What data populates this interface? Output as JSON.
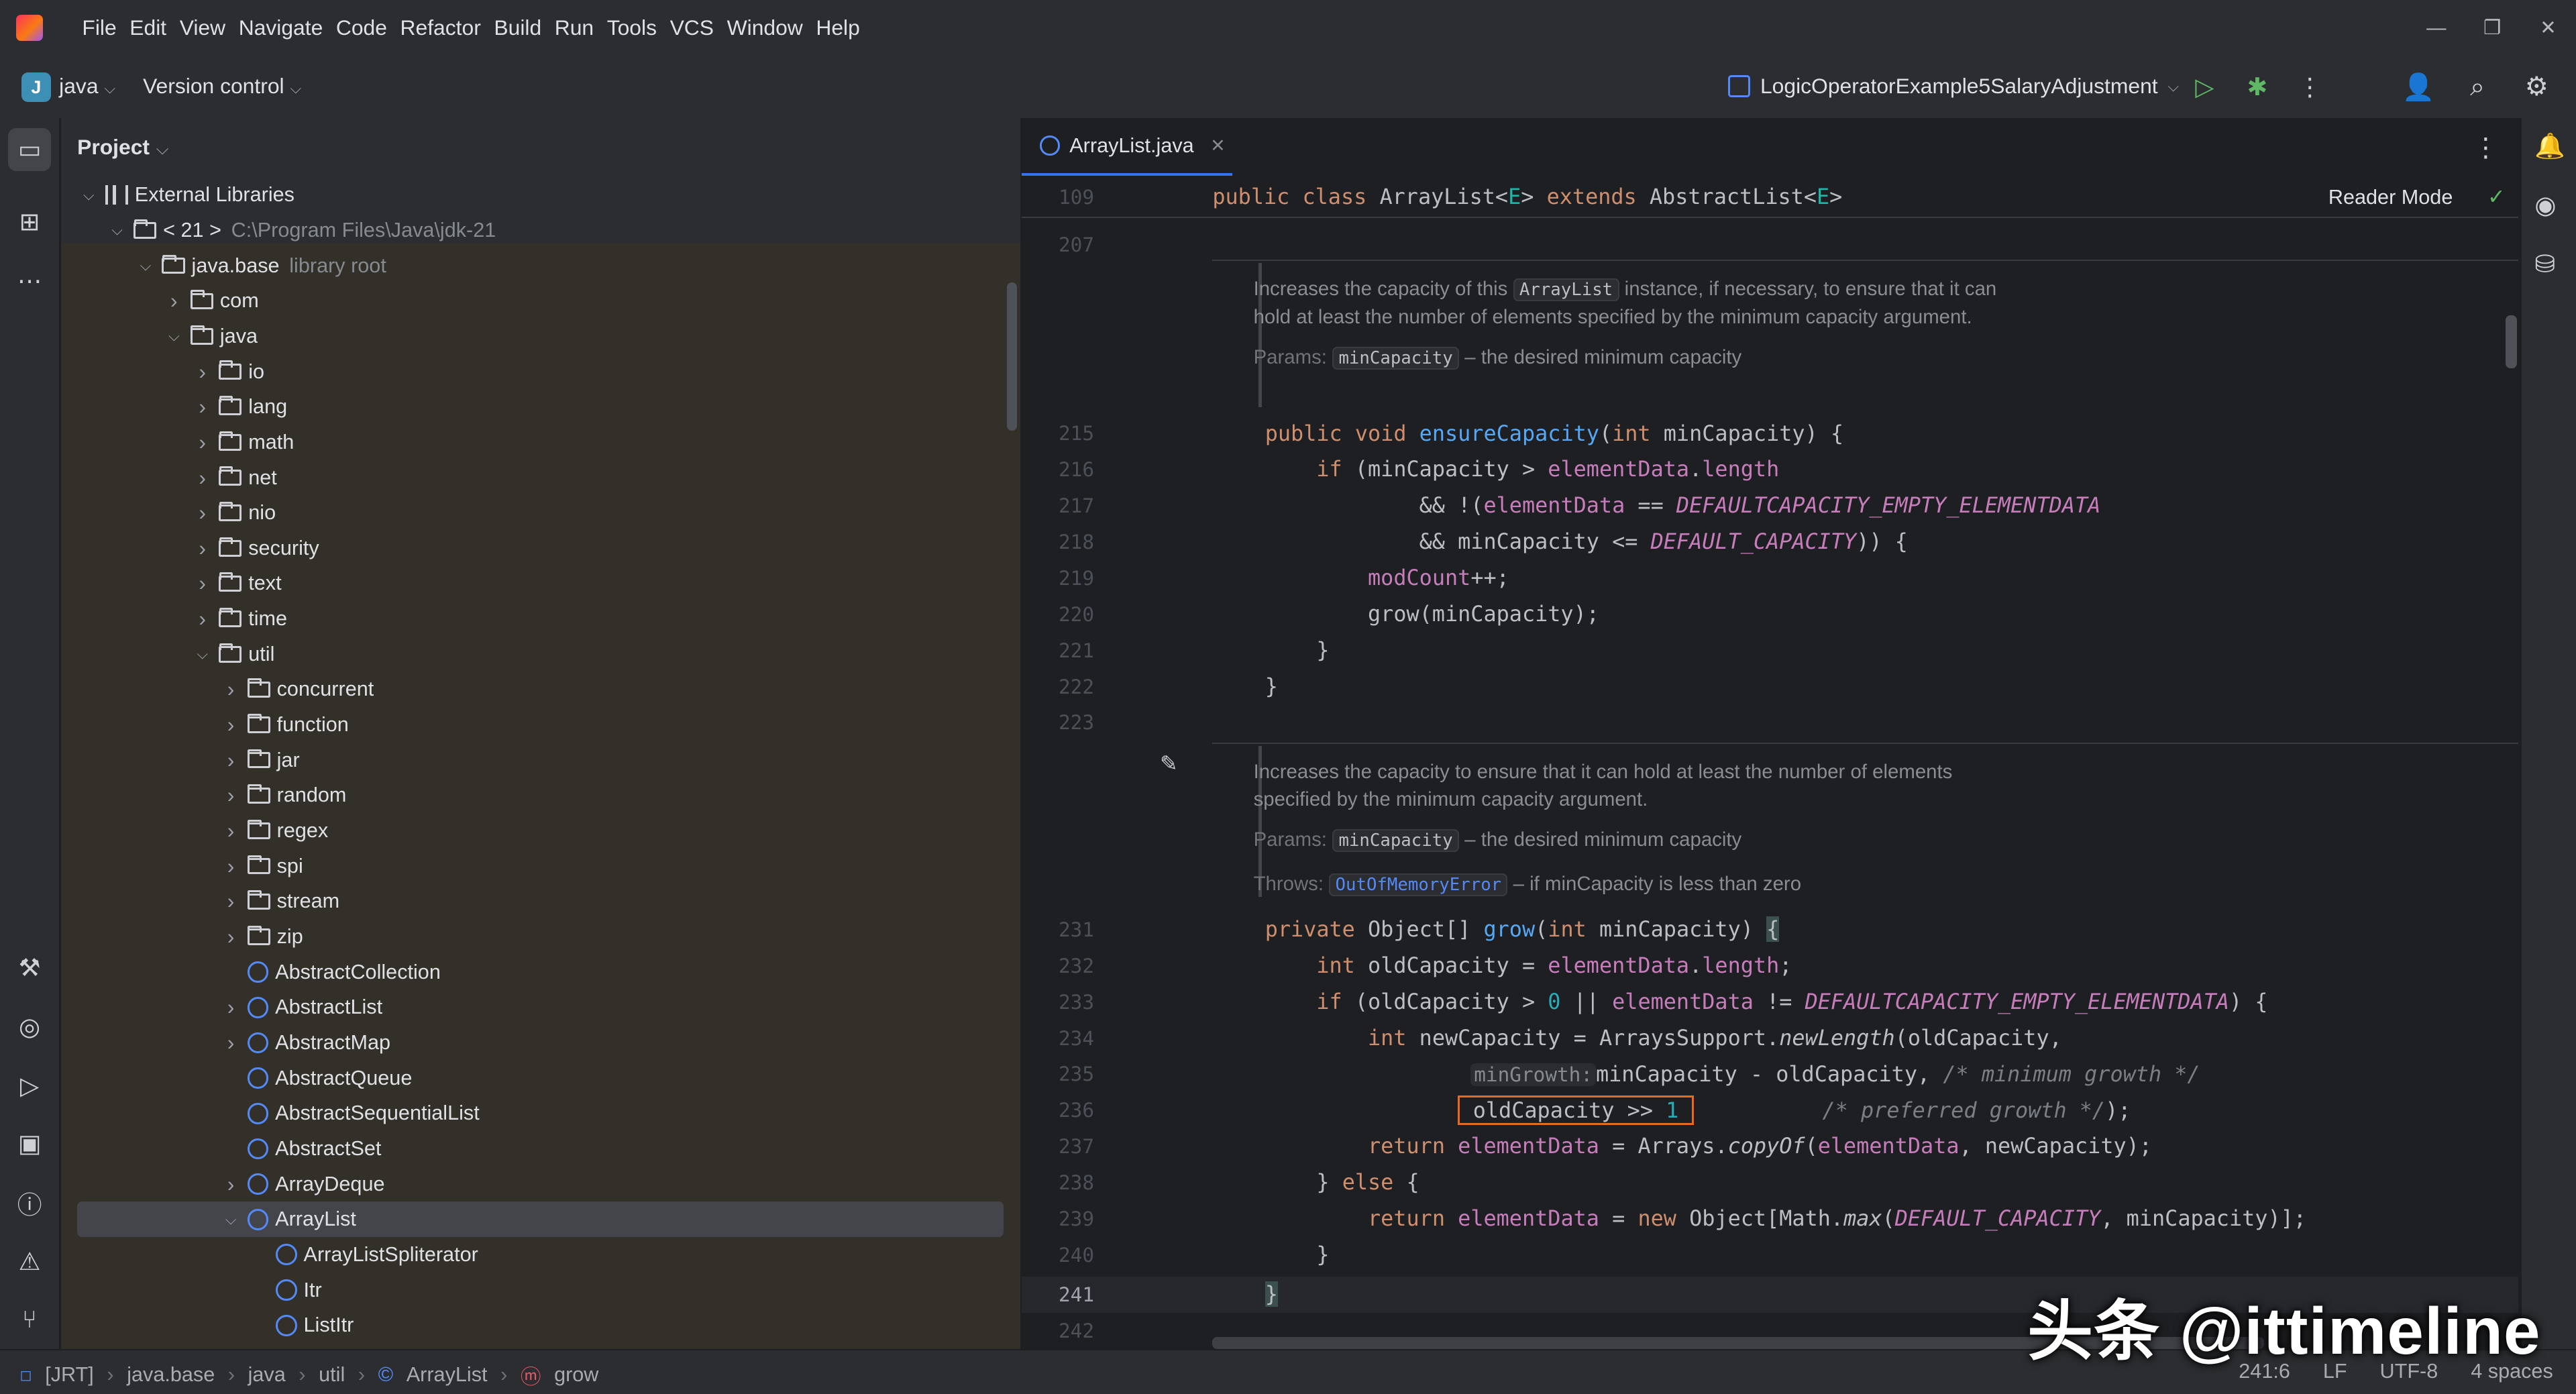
{
  "menu": [
    "File",
    "Edit",
    "View",
    "Navigate",
    "Code",
    "Refactor",
    "Build",
    "Run",
    "Tools",
    "VCS",
    "Window",
    "Help"
  ],
  "toolbar": {
    "project_badge": "J",
    "project_name": "java",
    "version_control": "Version control",
    "run_config": "LogicOperatorExample5SalaryAdjustment"
  },
  "project_panel": {
    "title": "Project",
    "tree": [
      {
        "label": "External Libraries",
        "depth": 0,
        "type": "lib",
        "expanded": true
      },
      {
        "label": "< 21 >",
        "sub": "C:\\Program Files\\Java\\jdk-21",
        "depth": 1,
        "type": "jdk",
        "expanded": true
      },
      {
        "label": "java.base",
        "sub": "library root",
        "depth": 2,
        "type": "folder",
        "expanded": true
      },
      {
        "label": "com",
        "depth": 3,
        "type": "folder",
        "expanded": false
      },
      {
        "label": "java",
        "depth": 3,
        "type": "folder",
        "expanded": true
      },
      {
        "label": "io",
        "depth": 4,
        "type": "folder",
        "expanded": false
      },
      {
        "label": "lang",
        "depth": 4,
        "type": "folder",
        "expanded": false
      },
      {
        "label": "math",
        "depth": 4,
        "type": "folder",
        "expanded": false
      },
      {
        "label": "net",
        "depth": 4,
        "type": "folder",
        "expanded": false
      },
      {
        "label": "nio",
        "depth": 4,
        "type": "folder",
        "expanded": false
      },
      {
        "label": "security",
        "depth": 4,
        "type": "folder",
        "expanded": false
      },
      {
        "label": "text",
        "depth": 4,
        "type": "folder",
        "expanded": false
      },
      {
        "label": "time",
        "depth": 4,
        "type": "folder",
        "expanded": false
      },
      {
        "label": "util",
        "depth": 4,
        "type": "folder",
        "expanded": true
      },
      {
        "label": "concurrent",
        "depth": 5,
        "type": "folder",
        "expanded": false
      },
      {
        "label": "function",
        "depth": 5,
        "type": "folder",
        "expanded": false
      },
      {
        "label": "jar",
        "depth": 5,
        "type": "folder",
        "expanded": false
      },
      {
        "label": "random",
        "depth": 5,
        "type": "folder",
        "expanded": false
      },
      {
        "label": "regex",
        "depth": 5,
        "type": "folder",
        "expanded": false
      },
      {
        "label": "spi",
        "depth": 5,
        "type": "folder",
        "expanded": false
      },
      {
        "label": "stream",
        "depth": 5,
        "type": "folder",
        "expanded": false
      },
      {
        "label": "zip",
        "depth": 5,
        "type": "folder",
        "expanded": false
      },
      {
        "label": "AbstractCollection",
        "depth": 5,
        "type": "class",
        "leaf": true
      },
      {
        "label": "AbstractList",
        "depth": 5,
        "type": "class",
        "expanded": false
      },
      {
        "label": "AbstractMap",
        "depth": 5,
        "type": "class",
        "expanded": false
      },
      {
        "label": "AbstractQueue",
        "depth": 5,
        "type": "class",
        "leaf": true
      },
      {
        "label": "AbstractSequentialList",
        "depth": 5,
        "type": "class",
        "leaf": true
      },
      {
        "label": "AbstractSet",
        "depth": 5,
        "type": "class",
        "leaf": true
      },
      {
        "label": "ArrayDeque",
        "depth": 5,
        "type": "class",
        "expanded": false
      },
      {
        "label": "ArrayList",
        "depth": 5,
        "type": "class",
        "expanded": true,
        "selected": true
      },
      {
        "label": "ArrayListSpliterator",
        "depth": 6,
        "type": "class",
        "leaf": true
      },
      {
        "label": "Itr",
        "depth": 6,
        "type": "class",
        "leaf": true
      },
      {
        "label": "ListItr",
        "depth": 6,
        "type": "class",
        "leaf": true
      }
    ]
  },
  "editor": {
    "tab": "ArrayList.java",
    "reader_mode": "Reader Mode",
    "sticky_line": "109",
    "gap_line": "207",
    "doc1": {
      "text_pre": "Increases the capacity of this ",
      "code": "ArrayList",
      "text_post": " instance, if necessary, to ensure that it can hold at least the number of elements specified by the minimum capacity argument.",
      "params_label": "Params:",
      "param_name": "minCapacity",
      "param_desc": " – the desired minimum capacity"
    },
    "doc2": {
      "text": "Increases the capacity to ensure that it can hold at least the number of elements specified by the minimum capacity argument.",
      "params_label": "Params:",
      "param_name": "minCapacity",
      "param_desc": " – the desired minimum capacity",
      "throws_label": "Throws:",
      "throws_name": "OutOfMemoryError",
      "throws_desc": " – if minCapacity is less than zero"
    },
    "line_numbers": [
      "215",
      "216",
      "217",
      "218",
      "219",
      "220",
      "221",
      "222",
      "223",
      "231",
      "232",
      "233",
      "234",
      "235",
      "236",
      "237",
      "238",
      "239",
      "240",
      "241",
      "242"
    ],
    "current_line": "241",
    "inlay_hint": "minGrowth:"
  },
  "status": {
    "crumbs": [
      "[JRT]",
      "java.base",
      "java",
      "util",
      "ArrayList",
      "grow"
    ],
    "position": "241:6",
    "line_sep": "LF",
    "encoding": "UTF-8",
    "indent": "4 spaces"
  },
  "watermark": "头条 @ittimeline"
}
